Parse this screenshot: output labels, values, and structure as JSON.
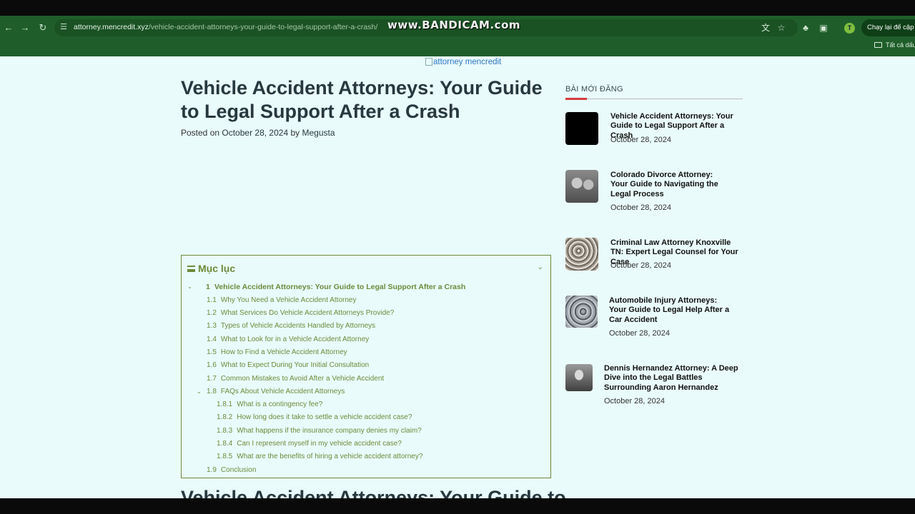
{
  "browser": {
    "url_host": "attorney.mencredit.xyz",
    "url_path": "/vehicle-accident-attorneys-your-guide-to-legal-support-after-a-crash/",
    "watermark": "www.BANDICAM.com",
    "profile_initial": "T",
    "resume_button": "Chạy lại để cập nhật",
    "bookmarks_label": "Tất cả dấu trang",
    "icons": [
      "back-icon",
      "forward-icon",
      "reload-icon",
      "site-info-icon",
      "translate-icon",
      "star-icon",
      "extension-icon",
      "puzzle-icon"
    ]
  },
  "page": {
    "logo_alt": "attorney mencredit",
    "title": "Vehicle Accident Attorneys: Your Guide to Legal Support After a Crash",
    "meta": {
      "posted_on": "Posted on",
      "date": "October 28, 2024",
      "by": "by",
      "author": "Megusta"
    },
    "toc": {
      "heading": "Mục lục",
      "items": [
        {
          "num": "1",
          "text": "Vehicle Accident Attorneys: Your Guide to Legal Support After a Crash"
        },
        {
          "num": "1.1",
          "text": "Why You Need a Vehicle Accident Attorney"
        },
        {
          "num": "1.2",
          "text": "What Services Do Vehicle Accident Attorneys Provide?"
        },
        {
          "num": "1.3",
          "text": "Types of Vehicle Accidents Handled by Attorneys"
        },
        {
          "num": "1.4",
          "text": "What to Look for in a Vehicle Accident Attorney"
        },
        {
          "num": "1.5",
          "text": "How to Find a Vehicle Accident Attorney"
        },
        {
          "num": "1.6",
          "text": "What to Expect During Your Initial Consultation"
        },
        {
          "num": "1.7",
          "text": "Common Mistakes to Avoid After a Vehicle Accident"
        },
        {
          "num": "1.8",
          "text": "FAQs About Vehicle Accident Attorneys"
        },
        {
          "num": "1.8.1",
          "text": "What is a contingency fee?"
        },
        {
          "num": "1.8.2",
          "text": "How long does it take to settle a vehicle accident case?"
        },
        {
          "num": "1.8.3",
          "text": "What happens if the insurance company denies my claim?"
        },
        {
          "num": "1.8.4",
          "text": "Can I represent myself in my vehicle accident case?"
        },
        {
          "num": "1.8.5",
          "text": "What are the benefits of hiring a vehicle accident attorney?"
        },
        {
          "num": "1.9",
          "text": "Conclusion"
        }
      ]
    },
    "next_heading": "Vehicle Accident Attorneys: Your Guide to"
  },
  "sidebar": {
    "title": "BÀI MỚI ĐĂNG",
    "posts": [
      {
        "title": "Vehicle Accident Attorneys: Your Guide to Legal Support After a Crash",
        "date": "October 28, 2024"
      },
      {
        "title": "Colorado Divorce Attorney: Your Guide to Navigating the Legal Process",
        "date": "October 28, 2024"
      },
      {
        "title": "Criminal Law Attorney Knoxville TN: Expert Legal Counsel for Your Case",
        "date": "October 28, 2024"
      },
      {
        "title": "Automobile Injury Attorneys: Your Guide to Legal Help After a Car Accident",
        "date": "October 28, 2024"
      },
      {
        "title": "Dennis Hernandez Attorney: A Deep Dive into the Legal Battles Surrounding Aaron Hernandez",
        "date": "October 28, 2024"
      }
    ]
  }
}
